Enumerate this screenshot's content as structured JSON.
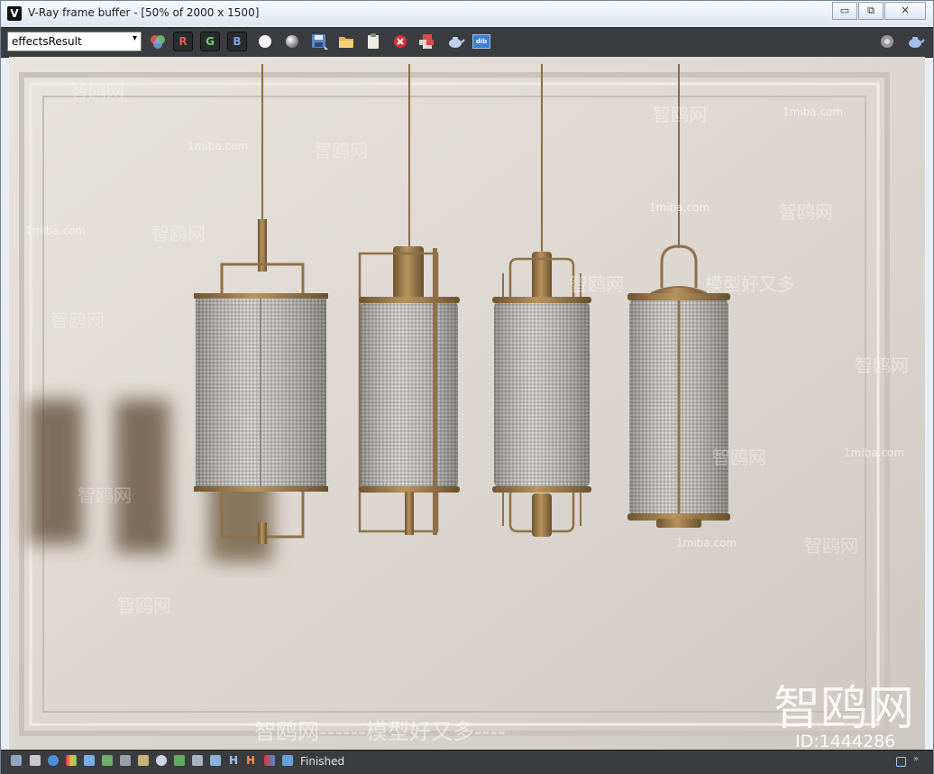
{
  "window": {
    "title": "V-Ray frame buffer - [50% of 2000 x 1500]",
    "app_icon_glyph": "V",
    "controls": {
      "minimize": "▭",
      "restore": "⧉",
      "close": "✕"
    }
  },
  "toolbar": {
    "channel_select": {
      "value": "effectsResult",
      "arrow": "▾"
    },
    "channel_buttons": {
      "r": "R",
      "g": "G",
      "b": "B"
    },
    "dib_label": "dib"
  },
  "status": {
    "text": "Finished",
    "h_label": "H",
    "hh_label": "H"
  },
  "render": {
    "watermark_small": "1miba.com",
    "watermark_cn_a": "智鸥网",
    "watermark_cn_b": "模型好又多",
    "bottom_banner": "智鸥网------模型好又多----",
    "brand_large": "智鸥网",
    "id_text": "ID:1444286"
  },
  "colors": {
    "brass": "#9a7a4e",
    "fabric": "#b9b8b4",
    "wall": "#dcd7d0",
    "toolbar_bg": "#3a3c3f",
    "r": "#e05b5b",
    "g": "#6fd26f",
    "b": "#7aa4ee"
  }
}
